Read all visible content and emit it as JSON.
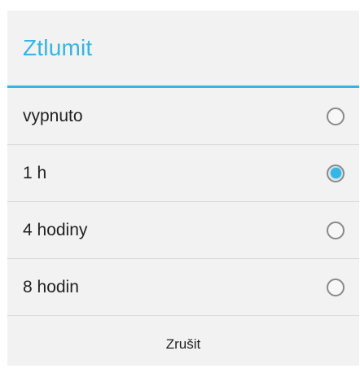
{
  "dialog": {
    "title": "Ztlumit",
    "accent_color": "#33b5e5",
    "options": [
      {
        "label": "vypnuto",
        "selected": false
      },
      {
        "label": "1 h",
        "selected": true
      },
      {
        "label": "4 hodiny",
        "selected": false
      },
      {
        "label": "8 hodin",
        "selected": false
      }
    ],
    "cancel_label": "Zrušit"
  }
}
